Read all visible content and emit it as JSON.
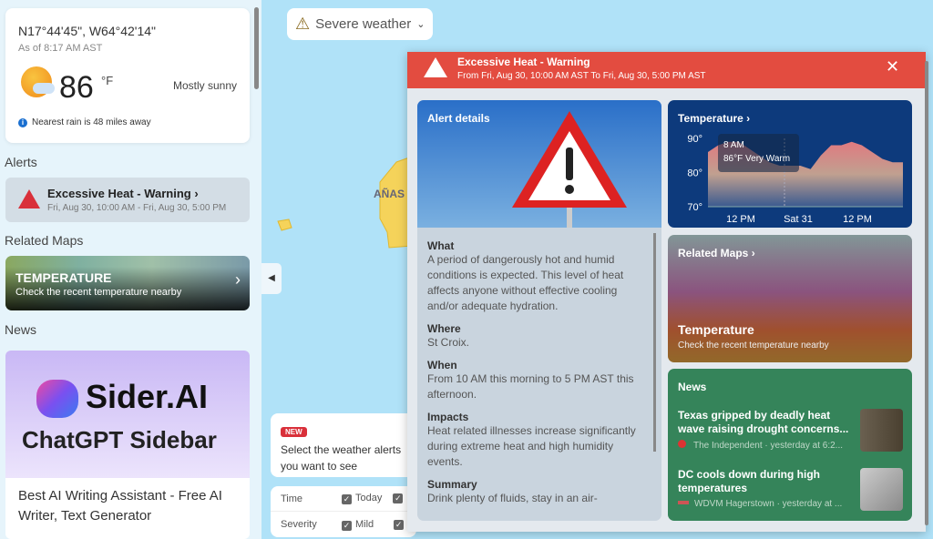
{
  "sidebar": {
    "coords": "N17°44'45\", W64°42'14\"",
    "as_of": "As of 8:17 AM AST",
    "temp": "86",
    "unit": "°F",
    "condition": "Mostly sunny",
    "rain_note": "Nearest rain is 48 miles away",
    "alerts_heading": "Alerts",
    "alert": {
      "title": "Excessive Heat - Warning",
      "time": "Fri, Aug 30, 10:00 AM - Fri, Aug 30, 5:00 PM"
    },
    "related_heading": "Related Maps",
    "related": {
      "title": "TEMPERATURE",
      "subtitle": "Check the recent temperature nearby"
    },
    "news_heading": "News",
    "ad": {
      "brand": "Sider.AI",
      "tagline": "ChatGPT Sidebar",
      "title": "Best AI Writing Assistant - Free AI Writer, Text Generator"
    }
  },
  "map": {
    "severe_button": "Severe weather",
    "place_label": "AÑAS",
    "tip": {
      "badge": "NEW",
      "text": "Select the weather alerts you want to see"
    },
    "filters": [
      {
        "label": "Time",
        "option": "Today"
      },
      {
        "label": "Severity",
        "option": "Mild"
      }
    ]
  },
  "popup": {
    "title": "Excessive Heat - Warning",
    "range": "From Fri, Aug 30, 10:00 AM AST To Fri, Aug 30, 5:00 PM AST",
    "details_label": "Alert details",
    "sections": [
      {
        "h": "What",
        "t": "A period of dangerously hot and humid conditions is expected. This level of heat affects anyone without effective cooling and/or adequate hydration."
      },
      {
        "h": "Where",
        "t": "St Croix."
      },
      {
        "h": "When",
        "t": "From 10 AM this morning to 5 PM AST this afternoon."
      },
      {
        "h": "Impacts",
        "t": "Heat related illnesses increase significantly during extreme heat and high humidity events."
      },
      {
        "h": "Summary",
        "t": "Drink plenty of fluids, stay in an air-"
      }
    ],
    "temperature": {
      "title": "Temperature",
      "y_ticks": [
        "90°",
        "80°",
        "70°"
      ],
      "x_ticks": [
        "12 PM",
        "Sat 31",
        "12 PM"
      ],
      "tooltip_time": "8 AM",
      "tooltip_value": "86°F Very Warm",
      "series_f": [
        86,
        88,
        89,
        89,
        87,
        85,
        83,
        82,
        82,
        82,
        81,
        85,
        88,
        88,
        89,
        88,
        86,
        84,
        83,
        83
      ]
    },
    "related": {
      "title": "Related Maps",
      "card_title": "Temperature",
      "card_sub": "Check the recent temperature nearby"
    },
    "news": {
      "title": "News",
      "items": [
        {
          "headline": "Texas gripped by deadly heat wave raising drought concerns...",
          "source": "The Independent · yesterday at 6:2..."
        },
        {
          "headline": "DC cools down during high temperatures",
          "source": "WDVM Hagerstown · yesterday at ..."
        }
      ]
    }
  },
  "colors": {
    "alert_red": "#e34c40",
    "temp_card": "#0d3a7c",
    "news_card": "#35845a"
  }
}
